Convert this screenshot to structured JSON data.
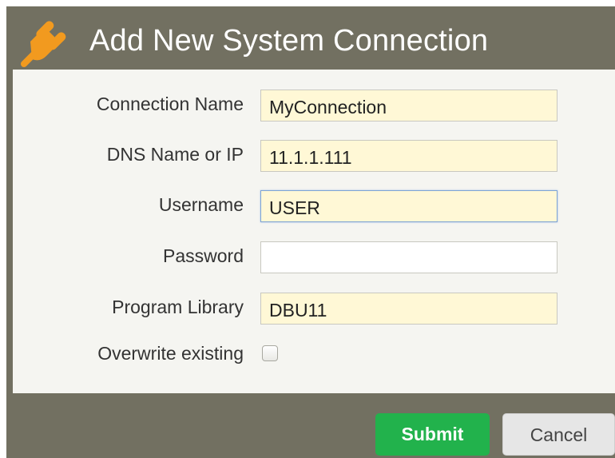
{
  "dialog": {
    "title": "Add New System Connection",
    "icon": "plug-icon",
    "accent_color": "#f29a1f",
    "background_color": "#727061"
  },
  "form": {
    "connection_name": {
      "label": "Connection Name",
      "value": "MyConnection"
    },
    "dns_name": {
      "label": "DNS Name or IP",
      "value": "11.1.1.111"
    },
    "username": {
      "label": "Username",
      "value": "USER"
    },
    "password": {
      "label": "Password",
      "value": ""
    },
    "program_library": {
      "label": "Program Library",
      "value": "DBU11"
    },
    "overwrite_existing": {
      "label": "Overwrite existing",
      "checked": false
    }
  },
  "buttons": {
    "submit_label": "Submit",
    "submit_color": "#22b24c",
    "cancel_label": "Cancel"
  }
}
